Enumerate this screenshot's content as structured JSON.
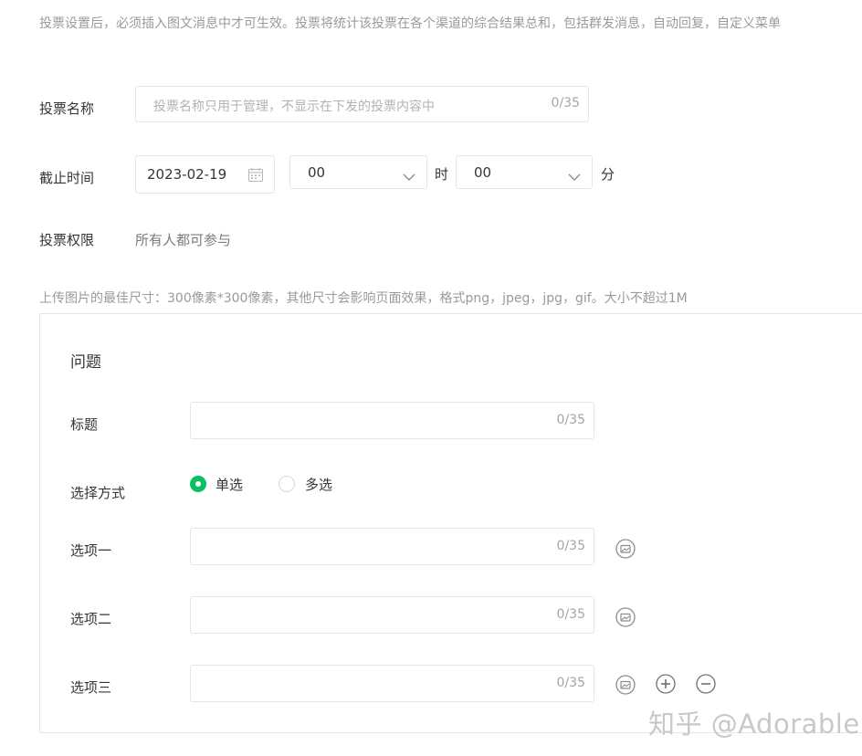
{
  "notice": "投票设置后，必须插入图文消息中才可生效。投票将统计该投票在各个渠道的综合结果总和，包括群发消息，自动回复，自定义菜单",
  "vote_name": {
    "label": "投票名称",
    "placeholder": "投票名称只用于管理，不显示在下发的投票内容中",
    "counter": "0/35"
  },
  "deadline": {
    "label": "截止时间",
    "date": "2023-02-19",
    "hour": "00",
    "hour_unit": "时",
    "minute": "00",
    "minute_unit": "分"
  },
  "permission": {
    "label": "投票权限",
    "value": "所有人都可参与"
  },
  "upload_hint": "上传图片的最佳尺寸：300像素*300像素，其他尺寸会影响页面效果，格式png，jpeg，jpg，gif。大小不超过1M",
  "question": {
    "heading": "问题",
    "title_label": "标题",
    "title_counter": "0/35",
    "mode_label": "选择方式",
    "mode_options": [
      {
        "label": "单选",
        "selected": true
      },
      {
        "label": "多选",
        "selected": false
      }
    ],
    "options": [
      {
        "label": "选项一",
        "counter": "0/35"
      },
      {
        "label": "选项二",
        "counter": "0/35"
      },
      {
        "label": "选项三",
        "counter": "0/35"
      }
    ]
  },
  "watermark": "知乎 @Adorable",
  "colors": {
    "accent": "#07c160",
    "border": "#e4e6eb",
    "muted": "#9a9a9a"
  },
  "icons": [
    "calendar-icon",
    "chevron-down-icon",
    "image-upload-icon",
    "add-circle-icon",
    "remove-circle-icon"
  ]
}
